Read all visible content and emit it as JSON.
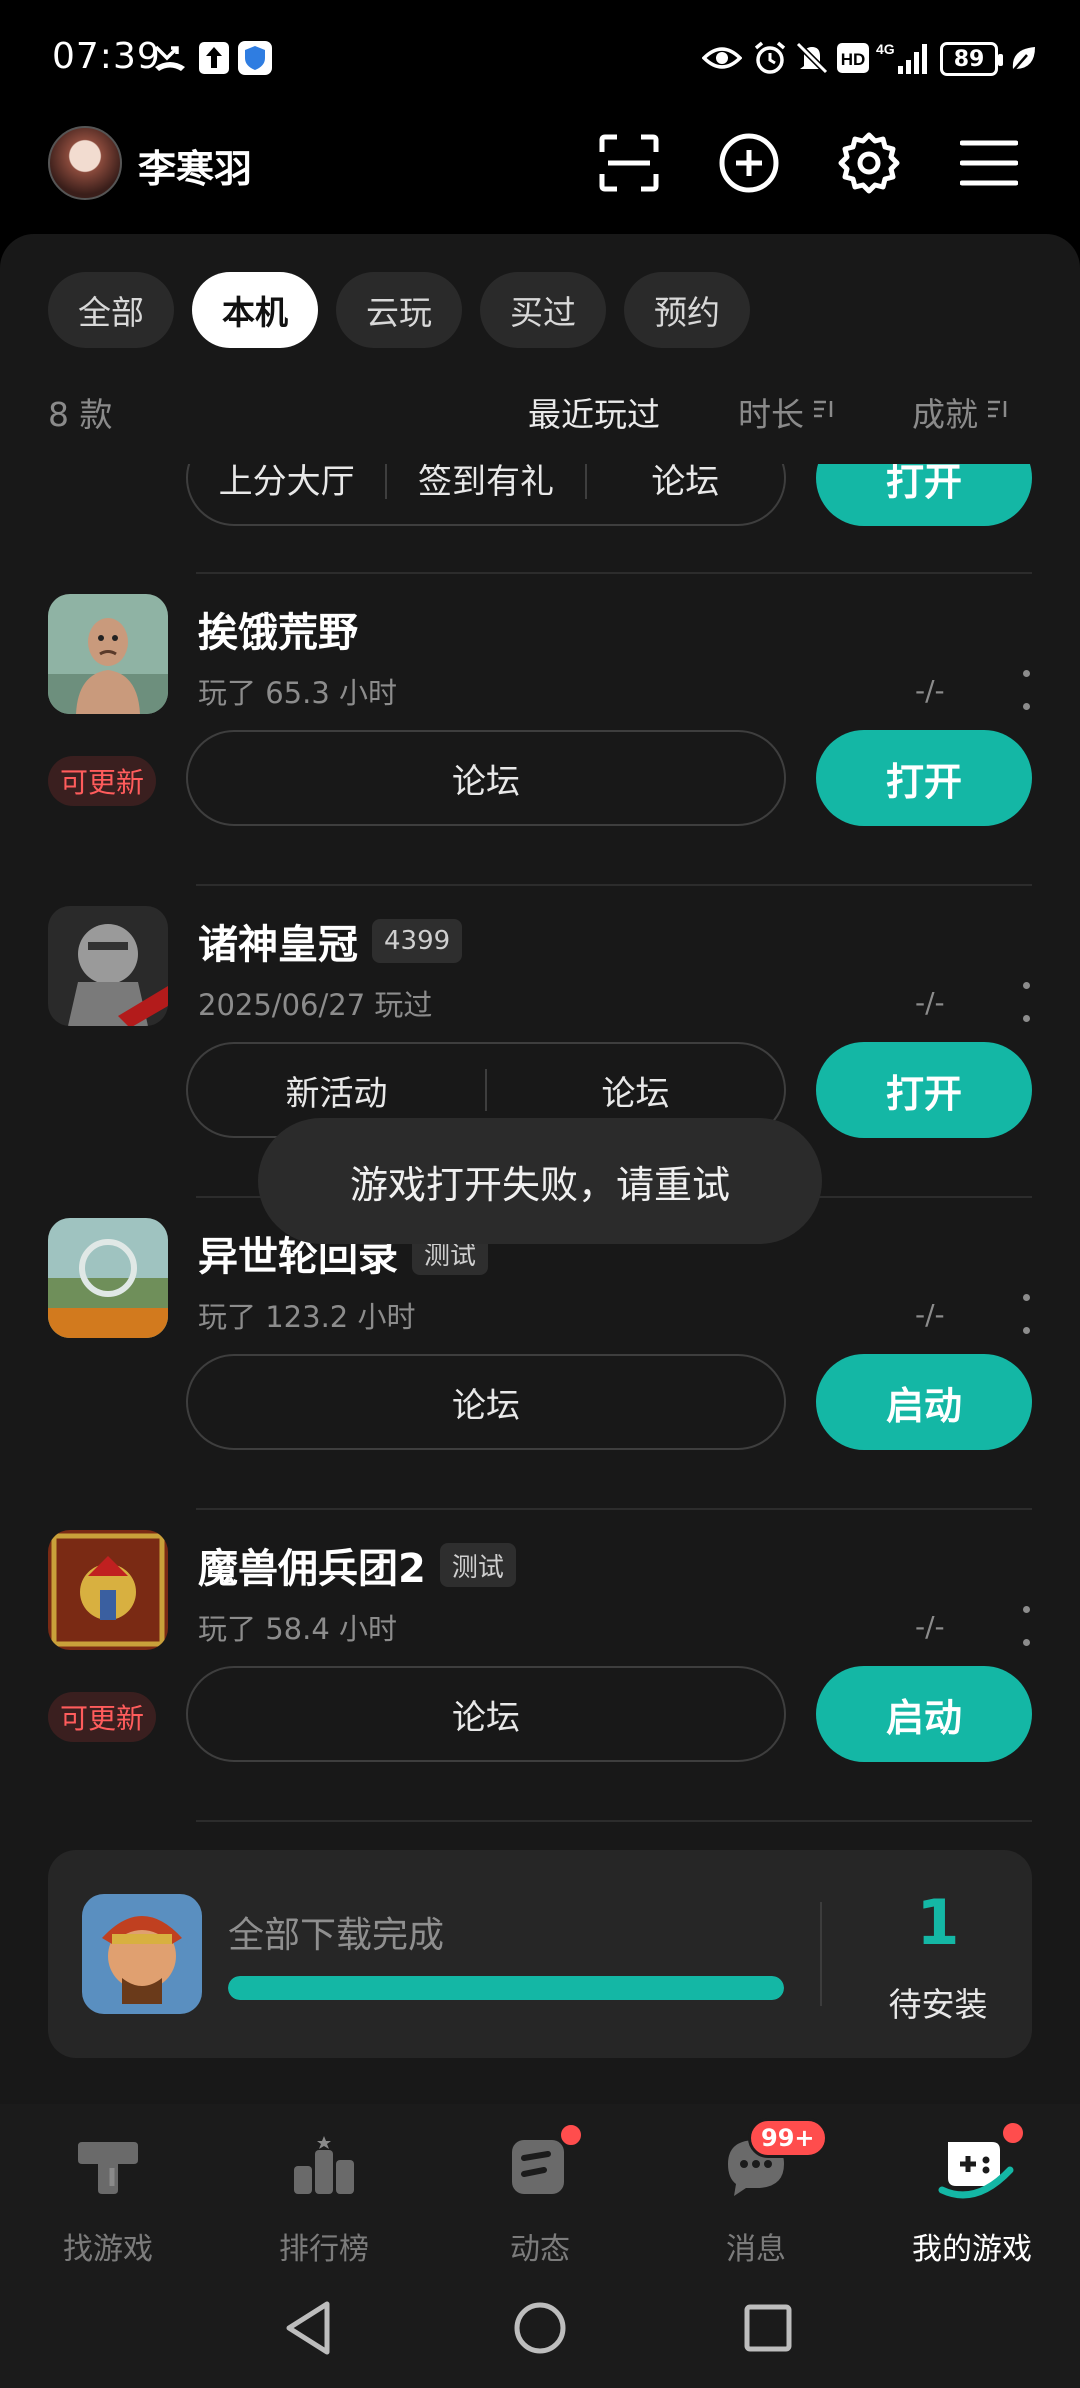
{
  "status_bar": {
    "time": "07:39",
    "network": "4G",
    "hd": "HD",
    "battery": "89"
  },
  "header": {
    "username": "李寒羽"
  },
  "filters": {
    "chips": [
      "全部",
      "本机",
      "云玩",
      "买过",
      "预约"
    ],
    "active": "本机"
  },
  "sort": {
    "count": "8 款",
    "options": [
      "最近玩过",
      "时长",
      "成就"
    ],
    "active": "最近玩过"
  },
  "partial_item": {
    "links": [
      "上分大厅",
      "签到有礼",
      "论坛"
    ],
    "action": "打开"
  },
  "games": [
    {
      "name": "挨饿荒野",
      "tag": "",
      "subtitle": "玩了 65.3 小时",
      "score": "-/-",
      "update_badge": "可更新",
      "links": [
        "论坛"
      ],
      "action": "打开"
    },
    {
      "name": "诸神皇冠",
      "tag": "4399",
      "subtitle": "2025/06/27 玩过",
      "score": "-/-",
      "update_badge": "",
      "links": [
        "新活动",
        "论坛"
      ],
      "action": "打开"
    },
    {
      "name": "异世轮回录",
      "tag": "测试",
      "subtitle": "玩了 123.2 小时",
      "score": "-/-",
      "update_badge": "",
      "links": [
        "论坛"
      ],
      "action": "启动"
    },
    {
      "name": "魔兽佣兵团2",
      "tag": "测试",
      "subtitle": "玩了 58.4 小时",
      "score": "-/-",
      "update_badge": "可更新",
      "links": [
        "论坛"
      ],
      "action": "启动"
    }
  ],
  "toast": "游戏打开失败，请重试",
  "download_card": {
    "status": "全部下载完成",
    "progress": 1.0,
    "pending_count": "1",
    "pending_label": "待安装"
  },
  "bottom_nav": {
    "items": [
      {
        "label": "找游戏",
        "icon": "find-games-icon"
      },
      {
        "label": "排行榜",
        "icon": "ranking-icon"
      },
      {
        "label": "动态",
        "icon": "feed-icon"
      },
      {
        "label": "消息",
        "icon": "message-icon",
        "badge": "99+"
      },
      {
        "label": "我的游戏",
        "icon": "my-games-icon"
      }
    ],
    "active": "我的游戏"
  },
  "colors": {
    "accent": "#14b7a5",
    "update": "#ff5c5c",
    "badge": "#ff4d4d",
    "background": "#000000",
    "sheet": "#181818"
  }
}
